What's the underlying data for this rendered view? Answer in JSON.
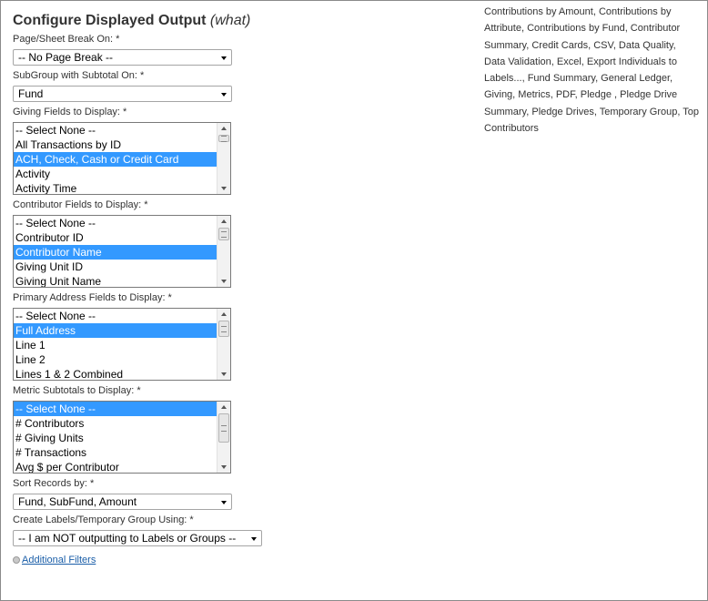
{
  "heading": {
    "main": "Configure Displayed Output",
    "sub": "(what)"
  },
  "fields": {
    "page_break": {
      "label": "Page/Sheet Break On: *",
      "value": "-- No Page Break --"
    },
    "subgroup": {
      "label": "SubGroup with Subtotal On: *",
      "value": "Fund"
    },
    "giving_fields": {
      "label": "Giving Fields to Display: *",
      "options": [
        "-- Select None --",
        "All Transactions by ID",
        "ACH, Check, Cash or Credit Card",
        "Activity",
        "Activity Time"
      ]
    },
    "contributor_fields": {
      "label": "Contributor Fields to Display: *",
      "options": [
        "-- Select None --",
        "Contributor ID",
        "Contributor Name",
        "Giving Unit ID",
        "Giving Unit Name"
      ]
    },
    "address_fields": {
      "label": "Primary Address Fields to Display: *",
      "options": [
        "-- Select None --",
        "Full Address",
        "Line 1",
        "Line 2",
        "Lines 1 & 2 Combined"
      ]
    },
    "metric_subtotals": {
      "label": "Metric Subtotals to Display: *",
      "options": [
        "-- Select None --",
        "# Contributors",
        "# Giving Units",
        "# Transactions",
        "Avg $ per Contributor"
      ]
    },
    "sort": {
      "label": "Sort Records by: *",
      "value": "Fund, SubFund, Amount"
    },
    "labels_group": {
      "label": "Create Labels/Temporary Group Using: *",
      "value": "-- I am NOT outputting to Labels or Groups --"
    }
  },
  "additional_filters": "Additional Filters",
  "right_panel": {
    "text": "Contributions by Amount, Contributions by Attribute, Contributions by Fund, Contributor Summary, Credit Cards, CSV, Data Quality, Data Validation, Excel, Export Individuals to Labels..., Fund Summary, General Ledger, Giving, Metrics, PDF, Pledge , Pledge Drive Summary, Pledge Drives, Temporary Group, Top Contributors"
  },
  "colors": {
    "selection": "#3399ff",
    "link": "#1a5ea8"
  }
}
